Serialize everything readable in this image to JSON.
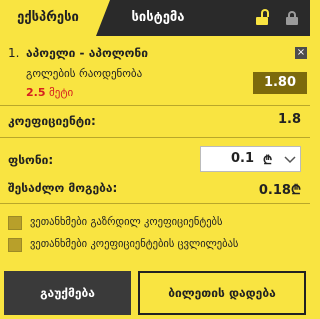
{
  "tabs": [
    {
      "label": "ექსპრესი",
      "active": true
    },
    {
      "label": "სისტემა",
      "active": false
    }
  ],
  "icons": {
    "open_lock": "lock-open-icon",
    "closed_lock": "lock-icon",
    "remove": "close-icon",
    "dropdown": "chevron-down-icon",
    "currency": "lari-icon"
  },
  "bet": {
    "index": "1.",
    "title": "აპოელი - აპოლონი",
    "market": "გოლების რაოდენობა",
    "selection_value": "2.5",
    "selection_unit": "მეტი",
    "odds": "1.80",
    "remove_label": "×"
  },
  "summary": {
    "coefficient_label": "კოეფიციენტი:",
    "coefficient_value": "1.8",
    "stake_label": "ფსონი:",
    "stake_value": "0.1",
    "stake_currency": "₾",
    "win_label": "შესაძლო მოგება:",
    "win_value": "0.18₾"
  },
  "options": [
    {
      "label": "ვეთანხმები გაზრდილ კოეფიციენტებს",
      "checked": false
    },
    {
      "label": "ვეთანხმები კოეფიციენტების ცვლილებას",
      "checked": false
    }
  ],
  "actions": {
    "clear_label": "გაუქმება",
    "place_label": "ბილეთის დადება"
  },
  "colors": {
    "accent": "#f9e441",
    "dark": "#2a2a2a",
    "odds_bg": "#7c6a0c",
    "highlight_red": "#d62020"
  }
}
